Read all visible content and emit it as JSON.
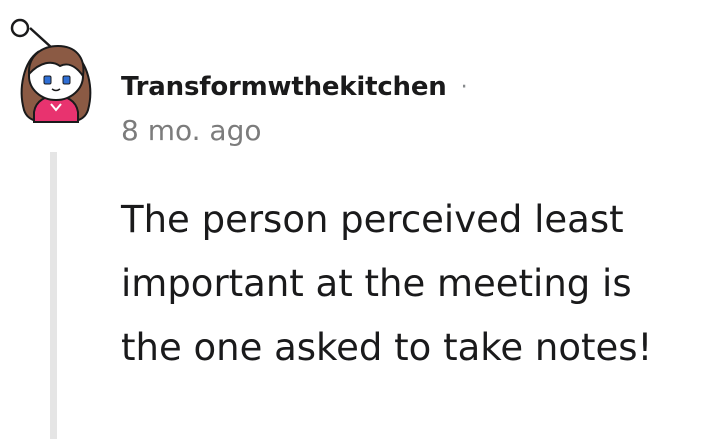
{
  "comment": {
    "author": "Transformwthekitchen",
    "separator": "·",
    "timestamp": "8 mo. ago",
    "body": "The person perceived least important at the meeting is the one asked to take notes!",
    "avatar_icon": "snoo-avatar-icon"
  },
  "colors": {
    "text": "#1a1a1b",
    "meta": "#7c7c7c",
    "thread_line": "#e5e5e5",
    "avatar_shirt": "#e8336f",
    "avatar_hair": "#8b5a44"
  }
}
